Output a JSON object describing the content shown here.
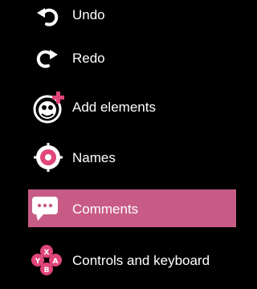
{
  "menu": {
    "items": [
      {
        "id": "undo",
        "label": "Undo",
        "icon": "undo-icon",
        "active": false
      },
      {
        "id": "redo",
        "label": "Redo",
        "icon": "redo-icon",
        "active": false
      },
      {
        "id": "add-elements",
        "label": "Add elements",
        "icon": "add-elements-icon",
        "active": false
      },
      {
        "id": "names",
        "label": "Names",
        "icon": "names-target-icon",
        "active": false
      },
      {
        "id": "comments",
        "label": "Comments",
        "icon": "comments-icon",
        "active": true
      },
      {
        "id": "controls-keyboard",
        "label": "Controls and keyboard",
        "icon": "gamepad-buttons-icon",
        "active": false
      }
    ]
  },
  "colors": {
    "background": "#000000",
    "text": "#ffffff",
    "active_bg": "#c75b86",
    "accent": "#e0457b"
  }
}
